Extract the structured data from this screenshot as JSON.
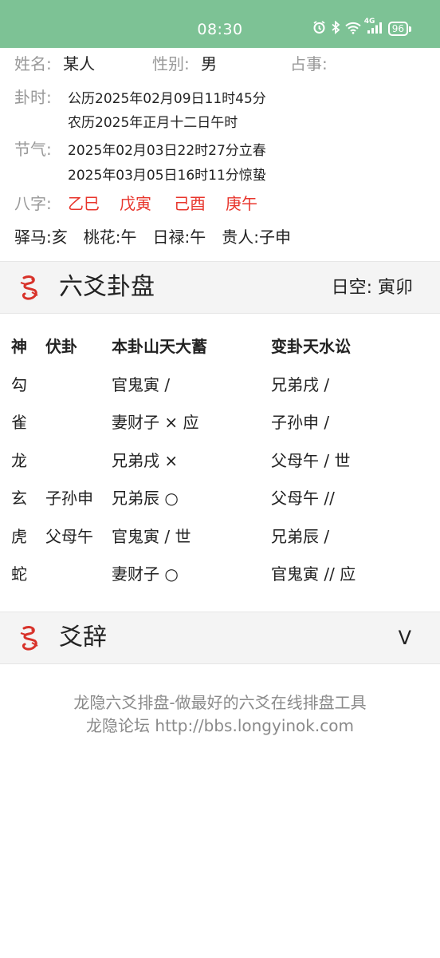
{
  "status_bar": {
    "time": "08:30",
    "network": "4G",
    "battery": "96",
    "icons": [
      "alarm-icon",
      "bluetooth-icon",
      "wifi-icon",
      "signal-icon",
      "battery-icon"
    ]
  },
  "info": {
    "name_label": "姓名:",
    "name_value": "某人",
    "gender_label": "性别:",
    "gender_value": "男",
    "matter_label": "占事:",
    "time_label": "卦时:",
    "gregorian": "公历2025年02月09日11时45分",
    "lunar": "农历2025年正月十二日午时",
    "term_label": "节气:",
    "term_1": "2025年02月03日22时27分立春",
    "term_2": "2025年03月05日16时11分惊蛰",
    "bazi_label": "八字:",
    "bazi": [
      "乙巳",
      "戊寅",
      "己酉",
      "庚午"
    ],
    "shensha": "驿马:亥　桃花:午　日禄:午　贵人:子申"
  },
  "pan_section": {
    "title": "六爻卦盘",
    "kong": "日空:  寅卯"
  },
  "table": {
    "headers": [
      "神",
      "伏卦",
      "本卦山天大蓄",
      "变卦天水讼"
    ],
    "rows": [
      [
        "勾",
        "",
        "官鬼寅 /",
        "兄弟戌 /"
      ],
      [
        "雀",
        "",
        "妻财子 × 应",
        "子孙申 /"
      ],
      [
        "龙",
        "",
        "兄弟戌 ×",
        "父母午 / 世"
      ],
      [
        "玄",
        "子孙申",
        "兄弟辰 ○",
        "父母午 //"
      ],
      [
        "虎",
        "父母午",
        "官鬼寅 / 世",
        "兄弟辰 /"
      ],
      [
        "蛇",
        "",
        "妻财子 ○",
        "官鬼寅 // 应"
      ]
    ]
  },
  "yaoci_section": {
    "title": "爻辞",
    "toggle": "V"
  },
  "footer": {
    "line1": "龙隐六爻排盘-做最好的六爻在线排盘工具",
    "line2": "龙隐论坛 http://bbs.longyinok.com"
  },
  "colors": {
    "status_bar": "#7dc295",
    "accent_red": "#e8352c",
    "label_gray": "#999999",
    "section_bg": "#f4f4f4"
  }
}
